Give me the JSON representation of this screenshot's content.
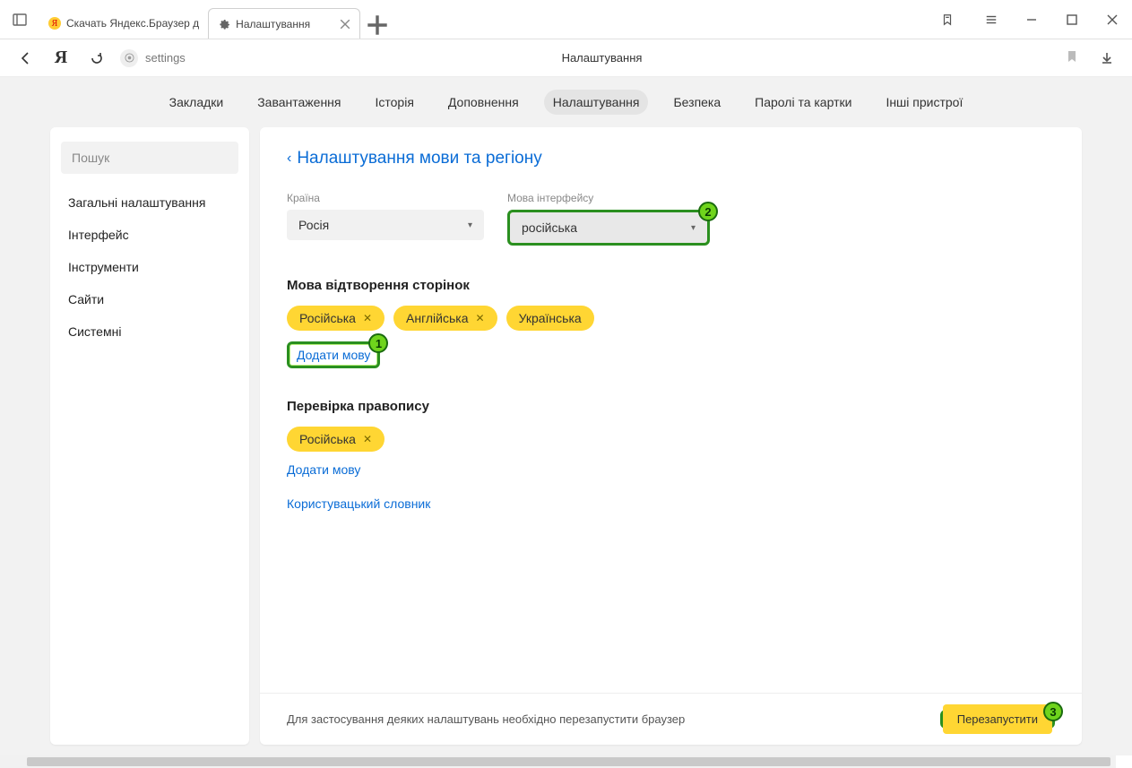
{
  "tabs": [
    {
      "title": "Скачать Яндекс.Браузер д",
      "active": false
    },
    {
      "title": "Налаштування",
      "active": true
    }
  ],
  "address": {
    "url_text": "settings",
    "page_label": "Налаштування"
  },
  "topnav": {
    "items": [
      "Закладки",
      "Завантаження",
      "Історія",
      "Доповнення",
      "Налаштування",
      "Безпека",
      "Паролі та картки",
      "Інші пристрої"
    ],
    "active_index": 4
  },
  "sidebar": {
    "search_placeholder": "Пошук",
    "items": [
      "Загальні налаштування",
      "Інтерфейс",
      "Інструменти",
      "Сайти",
      "Системні"
    ]
  },
  "content": {
    "breadcrumb": "Налаштування мови та регіону",
    "country_label": "Країна",
    "country_value": "Росія",
    "lang_label": "Мова інтерфейсу",
    "lang_value": "російська",
    "page_lang_heading": "Мова відтворення сторінок",
    "page_lang_pills": [
      "Російська",
      "Англійська",
      "Українська"
    ],
    "add_lang": "Додати мову",
    "spellcheck_heading": "Перевірка правопису",
    "spell_pills": [
      "Російська"
    ],
    "spell_add_lang": "Додати мову",
    "user_dict": "Користувацький словник",
    "footer_text": "Для застосування деяких налаштувань необхідно перезапустити браузер",
    "restart_btn": "Перезапустити"
  },
  "annotations": {
    "1": "1",
    "2": "2",
    "3": "3"
  }
}
